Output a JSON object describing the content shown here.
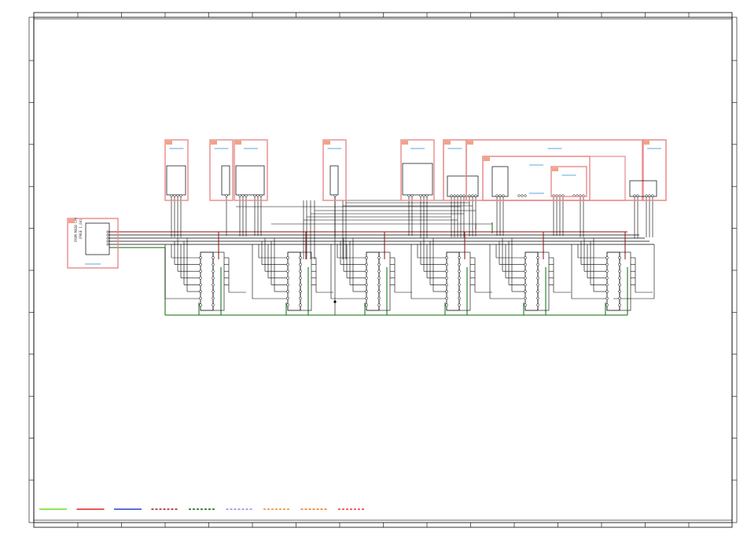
{
  "sheet": {
    "source_block_label_lines": [
      "FROM MAIN CPU",
      "(PAGE 1_04)"
    ]
  },
  "legend": {
    "items": [
      {
        "color": "#66dd22",
        "style": "solid"
      },
      {
        "color": "#e02020",
        "style": "solid"
      },
      {
        "color": "#2040d0",
        "style": "solid"
      },
      {
        "color": "#a01010",
        "style": "dashed"
      },
      {
        "color": "#106010",
        "style": "dashed"
      },
      {
        "color": "#9a80e0",
        "style": "dashed"
      },
      {
        "color": "#e09030",
        "style": "dashed"
      },
      {
        "color": "#f07010",
        "style": "dashed"
      },
      {
        "color": "#f03030",
        "style": "dashed"
      }
    ]
  },
  "colors": {
    "border": "#000000",
    "block_outline": "#e88a8a",
    "block_tab": "#f0a488",
    "block_title_line": "#2a8ad0",
    "wire": "#000000",
    "wire_power": "#8b1010",
    "wire_ground": "#0a6a0a"
  }
}
